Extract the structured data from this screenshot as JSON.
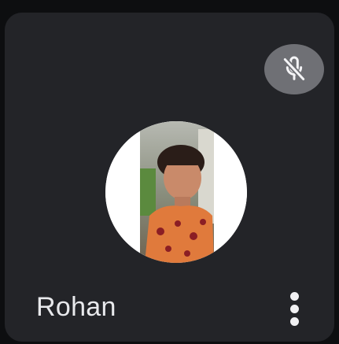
{
  "participant": {
    "name": "Rohan",
    "mic_status_icon": "mic-off-icon",
    "avatar_icon": "profile-photo",
    "more_options_icon": "more-vert-icon"
  },
  "colors": {
    "tile_background": "#232428",
    "page_background": "#0d0e10",
    "mute_badge": "#6f7075",
    "name_text": "#e8e9ec"
  }
}
